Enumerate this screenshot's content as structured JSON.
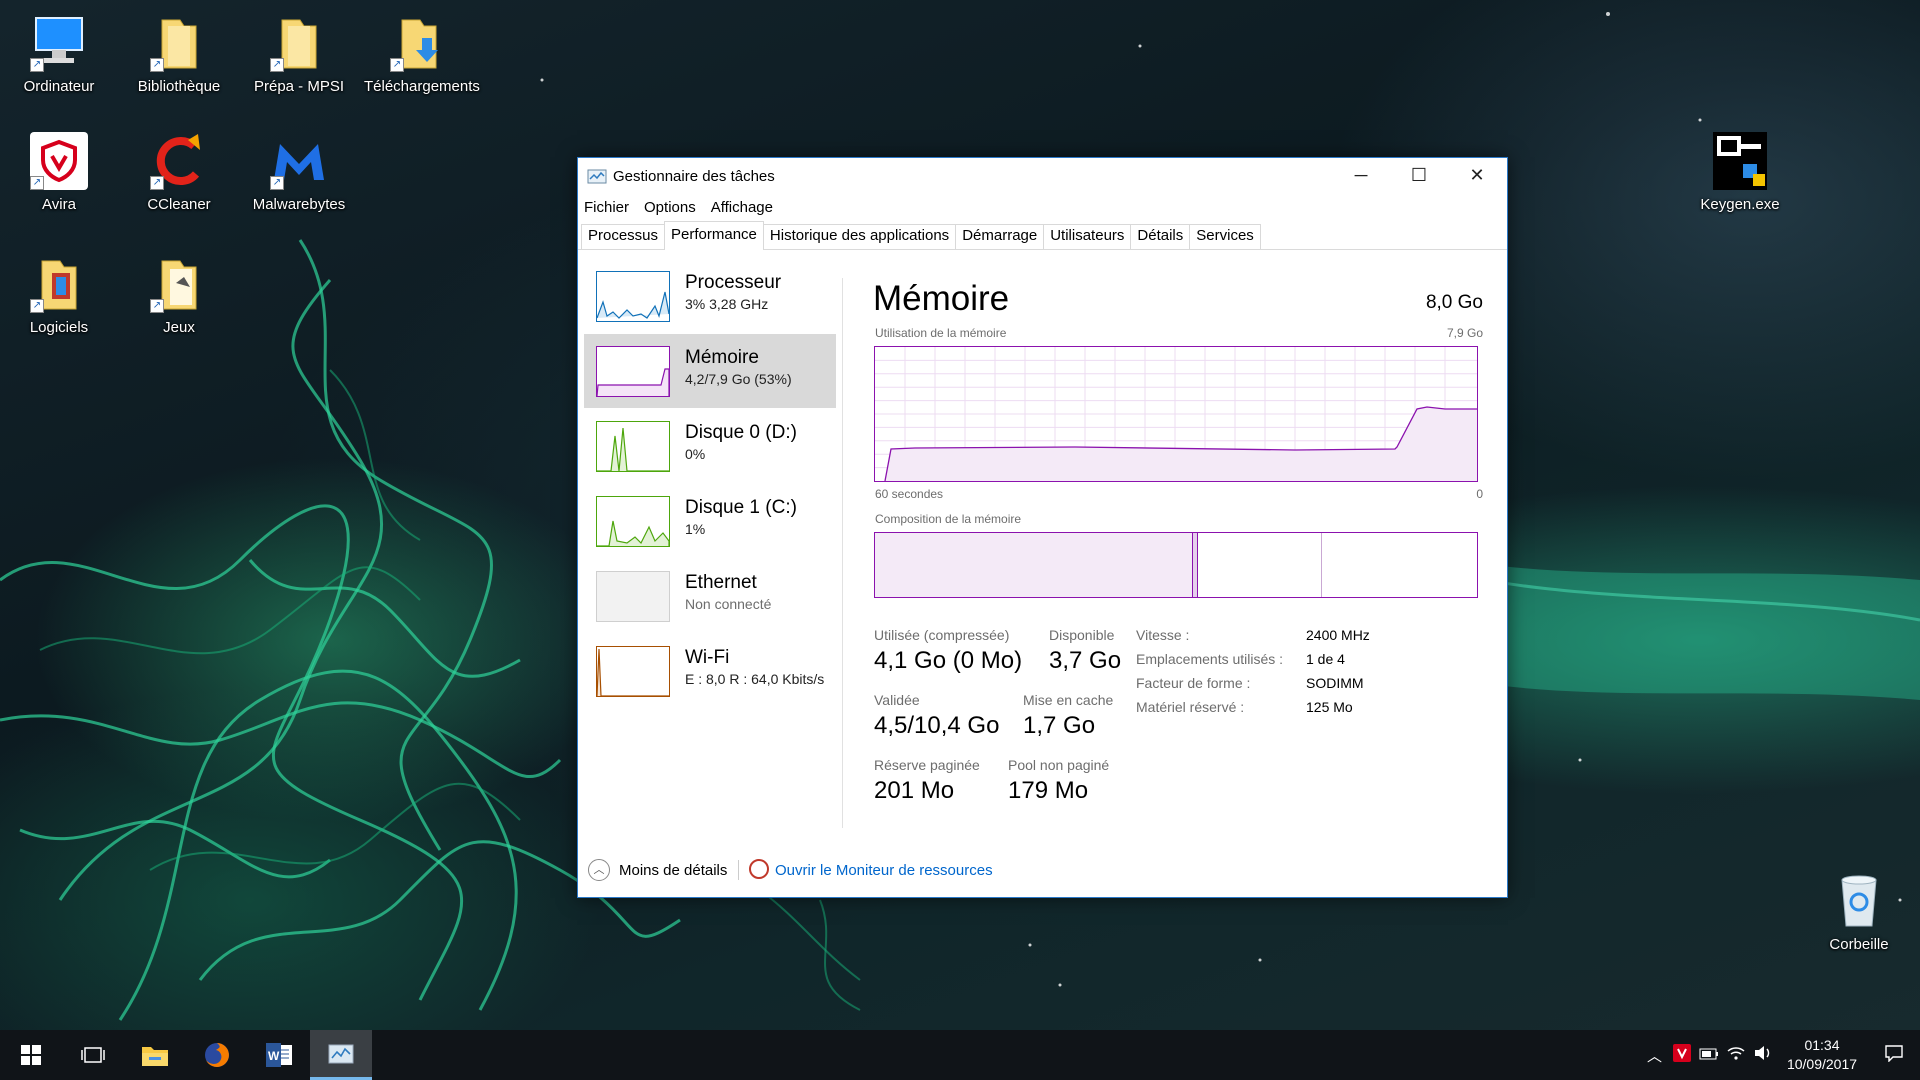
{
  "desktop": {
    "icons": [
      {
        "label": "Ordinateur",
        "icon": "computer-icon"
      },
      {
        "label": "Bibliothèque",
        "icon": "folder-icon"
      },
      {
        "label": "Prépa - MPSI",
        "icon": "folder-icon"
      },
      {
        "label": "Téléchargements",
        "icon": "downloads-folder-icon"
      },
      {
        "label": "Avira",
        "icon": "avira-icon"
      },
      {
        "label": "CCleaner",
        "icon": "ccleaner-icon"
      },
      {
        "label": "Malwarebytes",
        "icon": "malwarebytes-icon"
      },
      {
        "label": "Logiciels",
        "icon": "folder-icon"
      },
      {
        "label": "Jeux",
        "icon": "folder-icon"
      },
      {
        "label": "Keygen.exe",
        "icon": "keygen-icon"
      },
      {
        "label": "Corbeille",
        "icon": "recycle-bin-icon"
      }
    ]
  },
  "window": {
    "title": "Gestionnaire des tâches",
    "menu": [
      "Fichier",
      "Options",
      "Affichage"
    ],
    "tabs": [
      "Processus",
      "Performance",
      "Historique des applications",
      "Démarrage",
      "Utilisateurs",
      "Détails",
      "Services"
    ],
    "active_tab": "Performance",
    "perf_items": [
      {
        "name": "Processeur",
        "sub": "3% 3,28 GHz",
        "color": "#1171b8"
      },
      {
        "name": "Mémoire",
        "sub": "4,2/7,9 Go (53%)",
        "color": "#8b12ae"
      },
      {
        "name": "Disque 0 (D:)",
        "sub": "0%",
        "color": "#4da60c"
      },
      {
        "name": "Disque 1 (C:)",
        "sub": "1%",
        "color": "#4da60c"
      },
      {
        "name": "Ethernet",
        "sub": "Non connecté",
        "color": "#a7a7a7"
      },
      {
        "name": "Wi-Fi",
        "sub": "E : 8,0 R : 64,0 Kbits/s",
        "color": "#a74f01"
      }
    ],
    "memory": {
      "title": "Mémoire",
      "total": "8,0 Go",
      "usage_label": "Utilisation de la mémoire",
      "usage_max": "7,9 Go",
      "time_left": "60 secondes",
      "time_right": "0",
      "composition_label": "Composition de la mémoire",
      "stats": {
        "used_label": "Utilisée (compressée)",
        "used_value": "4,1 Go (0 Mo)",
        "available_label": "Disponible",
        "available_value": "3,7 Go",
        "committed_label": "Validée",
        "committed_value": "4,5/10,4 Go",
        "cached_label": "Mise en cache",
        "cached_value": "1,7 Go",
        "paged_label": "Réserve paginée",
        "paged_value": "201 Mo",
        "nonpaged_label": "Pool non paginé",
        "nonpaged_value": "179 Mo"
      },
      "props": [
        {
          "label": "Vitesse :",
          "value": "2400 MHz"
        },
        {
          "label": "Emplacements utilisés :",
          "value": "1 de 4"
        },
        {
          "label": "Facteur de forme :",
          "value": "SODIMM"
        },
        {
          "label": "Matériel réservé :",
          "value": "125 Mo"
        }
      ]
    },
    "footer": {
      "less_details": "Moins de détails",
      "open_monitor": "Ouvrir le Moniteur de ressources"
    }
  },
  "taskbar": {
    "time": "01:34",
    "date": "10/09/2017"
  },
  "colors": {
    "memory_accent": "#8b12ae",
    "link": "#0066cc",
    "taskbar_accent": "#76b9ed"
  }
}
